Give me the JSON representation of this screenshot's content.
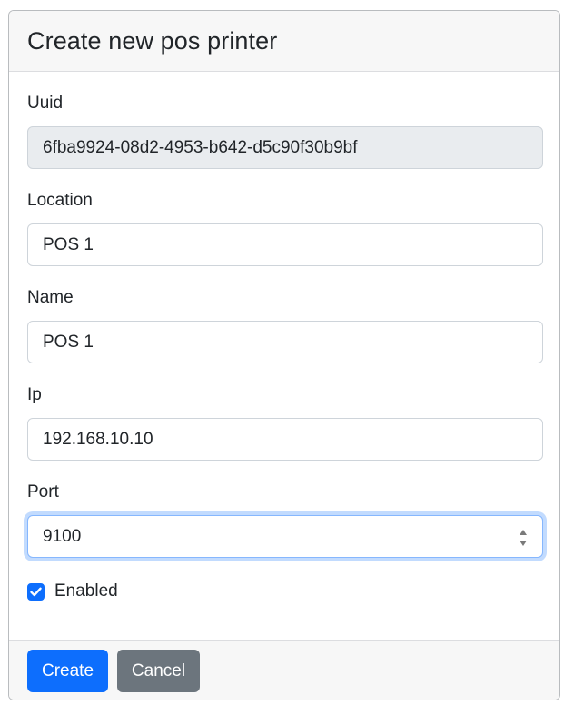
{
  "form": {
    "title": "Create new pos printer",
    "fields": {
      "uuid": {
        "label": "Uuid",
        "value": "6fba9924-08d2-4953-b642-d5c90f30b9bf"
      },
      "location": {
        "label": "Location",
        "value": "POS 1"
      },
      "name": {
        "label": "Name",
        "value": "POS 1"
      },
      "ip": {
        "label": "Ip",
        "value": "192.168.10.10"
      },
      "port": {
        "label": "Port",
        "value": "9100"
      }
    },
    "enabled": {
      "label": "Enabled",
      "checked": true
    },
    "buttons": {
      "create": "Create",
      "cancel": "Cancel"
    }
  },
  "colors": {
    "primary": "#0d6efd",
    "secondary": "#6c757d",
    "readonly_bg": "#e9ecef",
    "header_bg": "#f7f7f7"
  }
}
